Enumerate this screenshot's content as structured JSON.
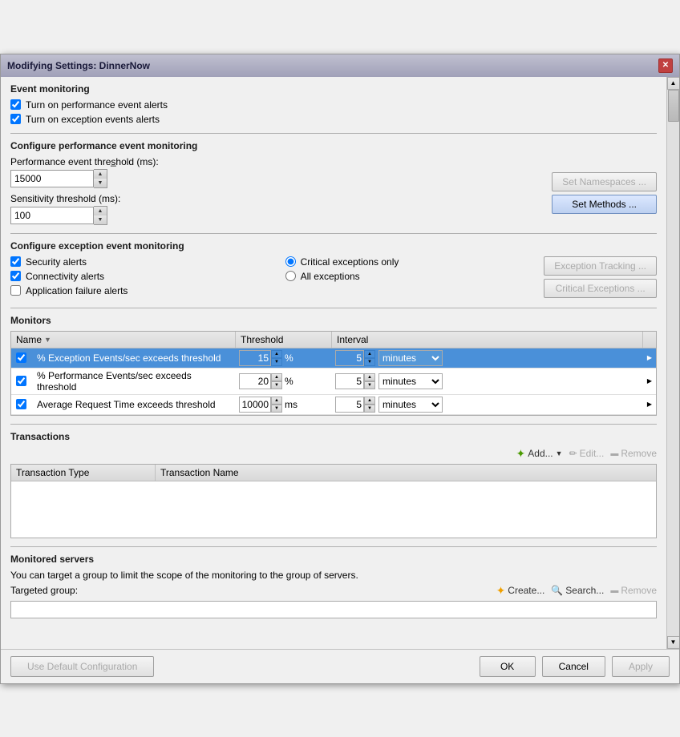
{
  "window": {
    "title": "Modifying Settings: DinnerNow"
  },
  "sections": {
    "event_monitoring": {
      "title": "Event monitoring",
      "checkboxes": [
        {
          "id": "cb_perf",
          "label": "Turn on performance event alerts",
          "checked": true
        },
        {
          "id": "cb_exc",
          "label": "Turn on exception events alerts",
          "checked": true
        }
      ]
    },
    "perf_config": {
      "title": "Configure performance event monitoring",
      "perf_threshold_label": "Performance event thres̲hold (ms):",
      "perf_threshold_value": "15000",
      "sensitivity_label": "Sensitivity threshold (ms):",
      "sensitivity_value": "100",
      "btn_set_namespaces": "Set Namespaces ...",
      "btn_set_methods": "Set Methods ..."
    },
    "exception_config": {
      "title": "Configure exception event monitoring",
      "checkboxes": [
        {
          "id": "cb_security",
          "label": "Security alerts",
          "checked": true
        },
        {
          "id": "cb_connectivity",
          "label": "Connectivity alerts",
          "checked": true
        },
        {
          "id": "cb_app_failure",
          "label": "Application failure alerts",
          "checked": false
        }
      ],
      "radios": [
        {
          "id": "rb_critical",
          "label": "Critical exceptions only",
          "checked": true
        },
        {
          "id": "rb_all",
          "label": "All exceptions",
          "checked": false
        }
      ],
      "btn_exception_tracking": "Exception Tracking ...",
      "btn_critical_exceptions": "Critical Exceptions ..."
    },
    "monitors": {
      "title": "Monitors",
      "columns": [
        {
          "label": "Name",
          "sort": "▼"
        },
        {
          "label": "Threshold"
        },
        {
          "label": "Interval"
        }
      ],
      "rows": [
        {
          "checked": true,
          "name": "% Exception Events/sec exceeds threshold",
          "threshold_value": "15",
          "threshold_unit": "%",
          "interval_value": "5",
          "interval_unit": "minutes",
          "selected": true
        },
        {
          "checked": true,
          "name": "% Performance Events/sec exceeds threshold",
          "threshold_value": "20",
          "threshold_unit": "%",
          "interval_value": "5",
          "interval_unit": "minutes",
          "selected": false
        },
        {
          "checked": true,
          "name": "Average Request Time exceeds threshold",
          "threshold_value": "10000",
          "threshold_unit": "ms",
          "interval_value": "5",
          "interval_unit": "minutes",
          "selected": false
        }
      ]
    },
    "transactions": {
      "title": "Transactions",
      "btn_add": "Add...",
      "btn_edit": "Edit...",
      "btn_remove": "Remove",
      "columns": [
        {
          "label": "Transaction Type"
        },
        {
          "label": "Transaction Name"
        }
      ]
    },
    "monitored_servers": {
      "title": "Monitored servers",
      "description": "You can target a group to limit the scope of the monitoring to the group of servers.",
      "targeted_label": "Targeted group:",
      "btn_create": "Create...",
      "btn_search": "Search...",
      "btn_remove": "Remove"
    }
  },
  "footer": {
    "btn_default": "Use Default Configuration",
    "btn_ok": "OK",
    "btn_cancel": "Cancel",
    "btn_apply": "Apply"
  }
}
